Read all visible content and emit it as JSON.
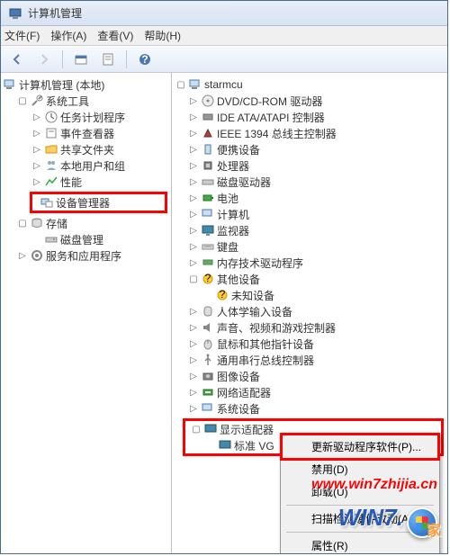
{
  "window": {
    "title": "计算机管理"
  },
  "menu": {
    "file": "文件(F)",
    "action": "操作(A)",
    "view": "查看(V)",
    "help": "帮助(H)"
  },
  "left_tree": {
    "root": "计算机管理 (本地)",
    "system_tools": "系统工具",
    "task_scheduler": "任务计划程序",
    "event_viewer": "事件查看器",
    "shared_folders": "共享文件夹",
    "local_users": "本地用户和组",
    "performance": "性能",
    "device_manager": "设备管理器",
    "storage": "存储",
    "disk_mgmt": "磁盘管理",
    "services_apps": "服务和应用程序"
  },
  "right_tree": {
    "root": "starmcu",
    "dvd": "DVD/CD-ROM 驱动器",
    "ide": "IDE ATA/ATAPI 控制器",
    "ieee1394": "IEEE 1394 总线主控制器",
    "portable": "便携设备",
    "processors": "处理器",
    "disk_drives": "磁盘驱动器",
    "batteries": "电池",
    "computer": "计算机",
    "monitors": "监视器",
    "keyboards": "键盘",
    "memory_tech": "内存技术驱动程序",
    "other_devices": "其他设备",
    "unknown_device": "未知设备",
    "hid": "人体学输入设备",
    "sound": "声音、视频和游戏控制器",
    "mice": "鼠标和其他指针设备",
    "usb": "通用串行总线控制器",
    "imaging": "图像设备",
    "network": "网络适配器",
    "system_devices": "系统设备",
    "display_adapters": "显示适配器",
    "standard_vga": "标准 VG"
  },
  "context_menu": {
    "update_driver": "更新驱动程序软件(P)...",
    "disable": "禁用(D)",
    "uninstall": "卸载(U)",
    "scan": "扫描检测硬件改动(A)",
    "properties": "属性(R)"
  },
  "watermark": "www.win7zhijia.cn",
  "win7logo": "WIN7."
}
